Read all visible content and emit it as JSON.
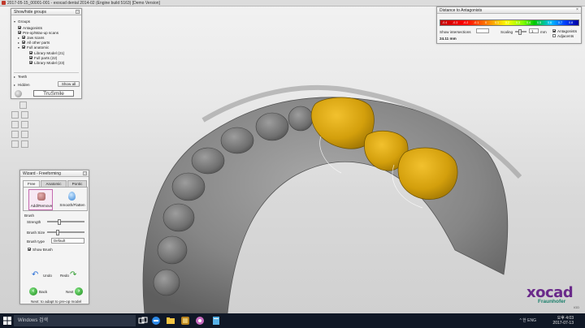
{
  "window": {
    "title": "2017-05-15_00001-001 - exocad dental 2014-02 (Engine build 5163) [Demo Version]"
  },
  "groups": {
    "header": "Show/hide groups",
    "help": "?",
    "section_groups": "Groups",
    "items": [
      {
        "label": "Antagonists",
        "checked": true
      },
      {
        "label": "Pre-op/Wax-up scans",
        "checked": true
      },
      {
        "label": "Jaw scans",
        "checked": true
      },
      {
        "label": "All other parts",
        "checked": true
      },
      {
        "label": "Full anatomic",
        "checked": true
      }
    ],
    "subitems": [
      {
        "label": "Library Model (21)",
        "checked": true
      },
      {
        "label": "Full parts (22)",
        "checked": true
      },
      {
        "label": "Library Model (23)",
        "checked": true
      }
    ],
    "section_teeth": "Teeth",
    "section_hidden": "Hidden",
    "show_all": "Show all",
    "trusmile": "TruSmile"
  },
  "distance": {
    "header": "Distance to Antagonists",
    "ticks": [
      "-0.4",
      "-0.3",
      "-0.2",
      "-0.1",
      "0",
      "0.1",
      "0.2",
      "0.3",
      "0.4",
      "0.5",
      "0.6",
      "0.7",
      "0.8"
    ],
    "show_intersections": "Show intersections",
    "scaling_label": "Scaling",
    "scaling_value": "1",
    "scaling_unit": "mm",
    "antagonists": "Antagonists",
    "adjacents": "Adjacents",
    "max_value": "24.11 mm",
    "accent": "#d4a400"
  },
  "wizard": {
    "header": "Wizard - Freeforming",
    "help": "?",
    "tabs": [
      "Free",
      "Anatomic",
      "Pontic"
    ],
    "tool_add": "Add/Remove",
    "tool_smooth": "Smooth/Flatten",
    "section_brush": "Brush",
    "strength": "Strength",
    "brush_size": "Brush Size",
    "brush_type": "Brush type",
    "brush_type_value": "Default",
    "show_brush": "Show Brush",
    "undo": "Undo",
    "redo": "Redo",
    "back": "Back",
    "next": "Next",
    "next_hint": "Next: to adapt to pre-op model"
  },
  "logo": {
    "brand": "xocad",
    "sub": "Fraunhofer",
    "note": "IGD"
  },
  "taskbar": {
    "search_placeholder": "Windows 검색",
    "tray": "^ 한 ENG",
    "time": "오후 4:03",
    "date": "2017-07-13"
  },
  "colors": {
    "tooth": "#d8a711",
    "jaw": "#8a8a8a",
    "background": "#e4e4e4"
  }
}
